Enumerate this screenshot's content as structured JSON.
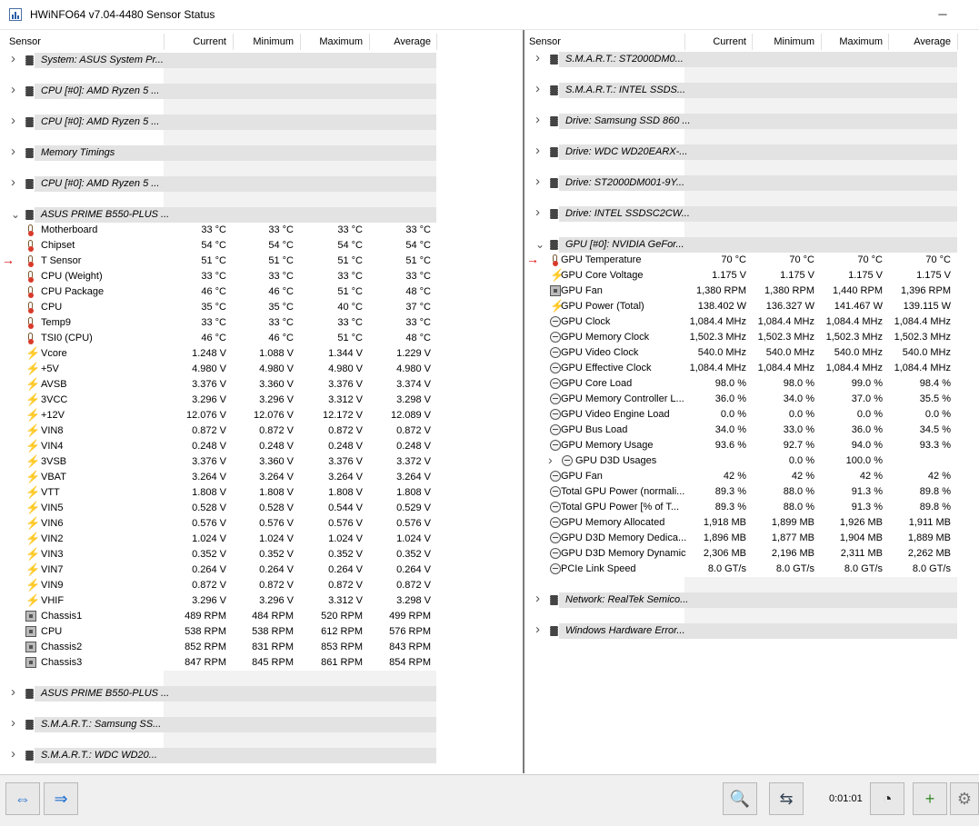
{
  "window": {
    "title": "HWiNFO64 v7.04-4480 Sensor Status",
    "minimize": "─",
    "close": "✕"
  },
  "columns": {
    "sensor": "Sensor",
    "current": "Current",
    "minimum": "Minimum",
    "maximum": "Maximum",
    "average": "Average"
  },
  "left": {
    "groups_top": [
      "System: ASUS System Pr...",
      "CPU [#0]: AMD Ryzen 5 ...",
      "CPU [#0]: AMD Ryzen 5 ...",
      "Memory Timings",
      "CPU [#0]: AMD Ryzen 5 ..."
    ],
    "expanded_group": "ASUS PRIME B550-PLUS ...",
    "rows": [
      {
        "icon": "thermometer-icon",
        "name": "Motherboard",
        "cur": "33 °C",
        "min": "33 °C",
        "max": "33 °C",
        "avg": "33 °C"
      },
      {
        "icon": "thermometer-icon",
        "name": "Chipset",
        "cur": "54 °C",
        "min": "54 °C",
        "max": "54 °C",
        "avg": "54 °C"
      },
      {
        "icon": "thermometer-icon",
        "name": "T Sensor",
        "cur": "51 °C",
        "min": "51 °C",
        "max": "51 °C",
        "avg": "51 °C",
        "marked": true
      },
      {
        "icon": "thermometer-icon",
        "name": "CPU (Weight)",
        "cur": "33 °C",
        "min": "33 °C",
        "max": "33 °C",
        "avg": "33 °C"
      },
      {
        "icon": "thermometer-icon",
        "name": "CPU Package",
        "cur": "46 °C",
        "min": "46 °C",
        "max": "51 °C",
        "avg": "48 °C"
      },
      {
        "icon": "thermometer-icon",
        "name": "CPU",
        "cur": "35 °C",
        "min": "35 °C",
        "max": "40 °C",
        "avg": "37 °C"
      },
      {
        "icon": "thermometer-icon",
        "name": "Temp9",
        "cur": "33 °C",
        "min": "33 °C",
        "max": "33 °C",
        "avg": "33 °C"
      },
      {
        "icon": "thermometer-icon",
        "name": "TSI0 (CPU)",
        "cur": "46 °C",
        "min": "46 °C",
        "max": "51 °C",
        "avg": "48 °C"
      },
      {
        "icon": "voltage-bolt-icon",
        "name": "Vcore",
        "cur": "1.248 V",
        "min": "1.088 V",
        "max": "1.344 V",
        "avg": "1.229 V"
      },
      {
        "icon": "voltage-bolt-icon",
        "name": "+5V",
        "cur": "4.980 V",
        "min": "4.980 V",
        "max": "4.980 V",
        "avg": "4.980 V"
      },
      {
        "icon": "voltage-bolt-icon",
        "name": "AVSB",
        "cur": "3.376 V",
        "min": "3.360 V",
        "max": "3.376 V",
        "avg": "3.374 V"
      },
      {
        "icon": "voltage-bolt-icon",
        "name": "3VCC",
        "cur": "3.296 V",
        "min": "3.296 V",
        "max": "3.312 V",
        "avg": "3.298 V"
      },
      {
        "icon": "voltage-bolt-icon",
        "name": "+12V",
        "cur": "12.076 V",
        "min": "12.076 V",
        "max": "12.172 V",
        "avg": "12.089 V"
      },
      {
        "icon": "voltage-bolt-icon",
        "name": "VIN8",
        "cur": "0.872 V",
        "min": "0.872 V",
        "max": "0.872 V",
        "avg": "0.872 V"
      },
      {
        "icon": "voltage-bolt-icon",
        "name": "VIN4",
        "cur": "0.248 V",
        "min": "0.248 V",
        "max": "0.248 V",
        "avg": "0.248 V"
      },
      {
        "icon": "voltage-bolt-icon",
        "name": "3VSB",
        "cur": "3.376 V",
        "min": "3.360 V",
        "max": "3.376 V",
        "avg": "3.372 V"
      },
      {
        "icon": "voltage-bolt-icon",
        "name": "VBAT",
        "cur": "3.264 V",
        "min": "3.264 V",
        "max": "3.264 V",
        "avg": "3.264 V"
      },
      {
        "icon": "voltage-bolt-icon",
        "name": "VTT",
        "cur": "1.808 V",
        "min": "1.808 V",
        "max": "1.808 V",
        "avg": "1.808 V"
      },
      {
        "icon": "voltage-bolt-icon",
        "name": "VIN5",
        "cur": "0.528 V",
        "min": "0.528 V",
        "max": "0.544 V",
        "avg": "0.529 V"
      },
      {
        "icon": "voltage-bolt-icon",
        "name": "VIN6",
        "cur": "0.576 V",
        "min": "0.576 V",
        "max": "0.576 V",
        "avg": "0.576 V"
      },
      {
        "icon": "voltage-bolt-icon",
        "name": "VIN2",
        "cur": "1.024 V",
        "min": "1.024 V",
        "max": "1.024 V",
        "avg": "1.024 V"
      },
      {
        "icon": "voltage-bolt-icon",
        "name": "VIN3",
        "cur": "0.352 V",
        "min": "0.352 V",
        "max": "0.352 V",
        "avg": "0.352 V"
      },
      {
        "icon": "voltage-bolt-icon",
        "name": "VIN7",
        "cur": "0.264 V",
        "min": "0.264 V",
        "max": "0.264 V",
        "avg": "0.264 V"
      },
      {
        "icon": "voltage-bolt-icon",
        "name": "VIN9",
        "cur": "0.872 V",
        "min": "0.872 V",
        "max": "0.872 V",
        "avg": "0.872 V"
      },
      {
        "icon": "voltage-bolt-icon",
        "name": "VHIF",
        "cur": "3.296 V",
        "min": "3.296 V",
        "max": "3.312 V",
        "avg": "3.298 V"
      },
      {
        "icon": "fan-icon",
        "name": "Chassis1",
        "cur": "489 RPM",
        "min": "484 RPM",
        "max": "520 RPM",
        "avg": "499 RPM"
      },
      {
        "icon": "fan-icon",
        "name": "CPU",
        "cur": "538 RPM",
        "min": "538 RPM",
        "max": "612 RPM",
        "avg": "576 RPM"
      },
      {
        "icon": "fan-icon",
        "name": "Chassis2",
        "cur": "852 RPM",
        "min": "831 RPM",
        "max": "853 RPM",
        "avg": "843 RPM"
      },
      {
        "icon": "fan-icon",
        "name": "Chassis3",
        "cur": "847 RPM",
        "min": "845 RPM",
        "max": "861 RPM",
        "avg": "854 RPM"
      }
    ],
    "groups_bottom": [
      "ASUS PRIME B550-PLUS ...",
      "S.M.A.R.T.: Samsung SS...",
      "S.M.A.R.T.: WDC WD20..."
    ]
  },
  "right": {
    "groups_top": [
      "S.M.A.R.T.: ST2000DM0...",
      "S.M.A.R.T.: INTEL SSDS...",
      "Drive: Samsung SSD 860 ...",
      "Drive: WDC WD20EARX-...",
      "Drive: ST2000DM001-9Y...",
      "Drive: INTEL SSDSC2CW..."
    ],
    "expanded_group": "GPU [#0]: NVIDIA GeFor...",
    "rows": [
      {
        "icon": "thermometer-icon",
        "name": "GPU Temperature",
        "cur": "70 °C",
        "min": "70 °C",
        "max": "70 °C",
        "avg": "70 °C",
        "marked": true
      },
      {
        "icon": "voltage-bolt-icon",
        "name": "GPU Core Voltage",
        "cur": "1.175 V",
        "min": "1.175 V",
        "max": "1.175 V",
        "avg": "1.175 V"
      },
      {
        "icon": "fan-icon",
        "name": "GPU Fan",
        "cur": "1,380 RPM",
        "min": "1,380 RPM",
        "max": "1,440 RPM",
        "avg": "1,396 RPM"
      },
      {
        "icon": "voltage-bolt-icon",
        "name": "GPU Power (Total)",
        "cur": "138.402 W",
        "min": "136.327 W",
        "max": "141.467 W",
        "avg": "139.115 W"
      },
      {
        "icon": "clock-icon",
        "name": "GPU Clock",
        "cur": "1,084.4 MHz",
        "min": "1,084.4 MHz",
        "max": "1,084.4 MHz",
        "avg": "1,084.4 MHz"
      },
      {
        "icon": "clock-icon",
        "name": "GPU Memory Clock",
        "cur": "1,502.3 MHz",
        "min": "1,502.3 MHz",
        "max": "1,502.3 MHz",
        "avg": "1,502.3 MHz"
      },
      {
        "icon": "clock-icon",
        "name": "GPU Video Clock",
        "cur": "540.0 MHz",
        "min": "540.0 MHz",
        "max": "540.0 MHz",
        "avg": "540.0 MHz"
      },
      {
        "icon": "clock-icon",
        "name": "GPU Effective Clock",
        "cur": "1,084.4 MHz",
        "min": "1,084.4 MHz",
        "max": "1,084.4 MHz",
        "avg": "1,084.4 MHz"
      },
      {
        "icon": "clock-icon",
        "name": "GPU Core Load",
        "cur": "98.0 %",
        "min": "98.0 %",
        "max": "99.0 %",
        "avg": "98.4 %"
      },
      {
        "icon": "clock-icon",
        "name": "GPU Memory Controller L...",
        "cur": "36.0 %",
        "min": "34.0 %",
        "max": "37.0 %",
        "avg": "35.5 %"
      },
      {
        "icon": "clock-icon",
        "name": "GPU Video Engine Load",
        "cur": "0.0 %",
        "min": "0.0 %",
        "max": "0.0 %",
        "avg": "0.0 %"
      },
      {
        "icon": "clock-icon",
        "name": "GPU Bus Load",
        "cur": "34.0 %",
        "min": "33.0 %",
        "max": "36.0 %",
        "avg": "34.5 %"
      },
      {
        "icon": "clock-icon",
        "name": "GPU Memory Usage",
        "cur": "93.6 %",
        "min": "92.7 %",
        "max": "94.0 %",
        "avg": "93.3 %"
      },
      {
        "icon": "clock-icon",
        "name": "GPU D3D Usages",
        "cur": "",
        "min": "0.0 %",
        "max": "100.0 %",
        "avg": "",
        "subgroup": true
      },
      {
        "icon": "clock-icon",
        "name": "GPU Fan",
        "cur": "42 %",
        "min": "42 %",
        "max": "42 %",
        "avg": "42 %"
      },
      {
        "icon": "clock-icon",
        "name": "Total GPU Power (normali...",
        "cur": "89.3 %",
        "min": "88.0 %",
        "max": "91.3 %",
        "avg": "89.8 %"
      },
      {
        "icon": "clock-icon",
        "name": "Total GPU Power [% of T...",
        "cur": "89.3 %",
        "min": "88.0 %",
        "max": "91.3 %",
        "avg": "89.8 %"
      },
      {
        "icon": "clock-icon",
        "name": "GPU Memory Allocated",
        "cur": "1,918 MB",
        "min": "1,899 MB",
        "max": "1,926 MB",
        "avg": "1,911 MB"
      },
      {
        "icon": "clock-icon",
        "name": "GPU D3D Memory Dedica...",
        "cur": "1,896 MB",
        "min": "1,877 MB",
        "max": "1,904 MB",
        "avg": "1,889 MB"
      },
      {
        "icon": "clock-icon",
        "name": "GPU D3D Memory Dynamic",
        "cur": "2,306 MB",
        "min": "2,196 MB",
        "max": "2,311 MB",
        "avg": "2,262 MB"
      },
      {
        "icon": "clock-icon",
        "name": "PCIe Link Speed",
        "cur": "8.0 GT/s",
        "min": "8.0 GT/s",
        "max": "8.0 GT/s",
        "avg": "8.0 GT/s"
      }
    ],
    "groups_bottom": [
      "Network: RealTek Semico...",
      "Windows Hardware Error..."
    ]
  },
  "toolbar": {
    "nav_left_icon": "expand-collapse-icon",
    "nav_right_icon": "move-panel-icon",
    "timer": "0:01:01",
    "buttons": [
      "monitor-search-icon",
      "network-computers-icon",
      "clock-icon",
      "add-log-icon",
      "settings-gear-icon"
    ]
  }
}
